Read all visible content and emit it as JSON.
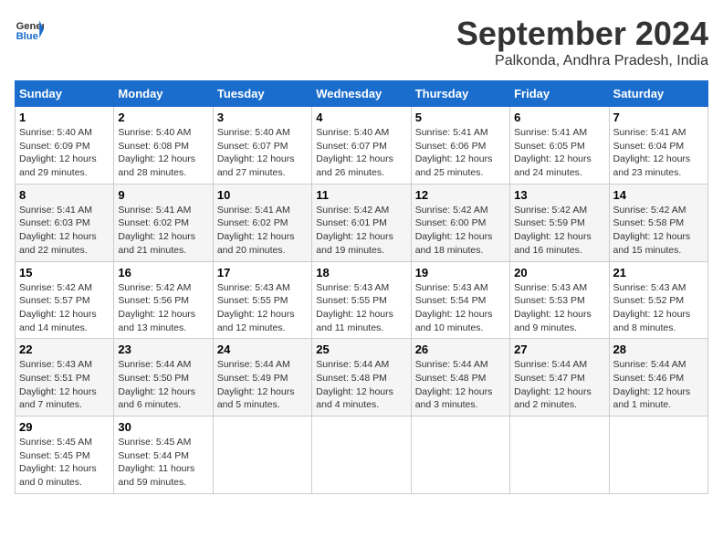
{
  "header": {
    "logo_general": "General",
    "logo_blue": "Blue",
    "month": "September 2024",
    "location": "Palkonda, Andhra Pradesh, India"
  },
  "weekdays": [
    "Sunday",
    "Monday",
    "Tuesday",
    "Wednesday",
    "Thursday",
    "Friday",
    "Saturday"
  ],
  "weeks": [
    [
      {
        "day": "1",
        "sunrise": "5:40 AM",
        "sunset": "6:09 PM",
        "daylight": "12 hours and 29 minutes."
      },
      {
        "day": "2",
        "sunrise": "5:40 AM",
        "sunset": "6:08 PM",
        "daylight": "12 hours and 28 minutes."
      },
      {
        "day": "3",
        "sunrise": "5:40 AM",
        "sunset": "6:07 PM",
        "daylight": "12 hours and 27 minutes."
      },
      {
        "day": "4",
        "sunrise": "5:40 AM",
        "sunset": "6:07 PM",
        "daylight": "12 hours and 26 minutes."
      },
      {
        "day": "5",
        "sunrise": "5:41 AM",
        "sunset": "6:06 PM",
        "daylight": "12 hours and 25 minutes."
      },
      {
        "day": "6",
        "sunrise": "5:41 AM",
        "sunset": "6:05 PM",
        "daylight": "12 hours and 24 minutes."
      },
      {
        "day": "7",
        "sunrise": "5:41 AM",
        "sunset": "6:04 PM",
        "daylight": "12 hours and 23 minutes."
      }
    ],
    [
      {
        "day": "8",
        "sunrise": "5:41 AM",
        "sunset": "6:03 PM",
        "daylight": "12 hours and 22 minutes."
      },
      {
        "day": "9",
        "sunrise": "5:41 AM",
        "sunset": "6:02 PM",
        "daylight": "12 hours and 21 minutes."
      },
      {
        "day": "10",
        "sunrise": "5:41 AM",
        "sunset": "6:02 PM",
        "daylight": "12 hours and 20 minutes."
      },
      {
        "day": "11",
        "sunrise": "5:42 AM",
        "sunset": "6:01 PM",
        "daylight": "12 hours and 19 minutes."
      },
      {
        "day": "12",
        "sunrise": "5:42 AM",
        "sunset": "6:00 PM",
        "daylight": "12 hours and 18 minutes."
      },
      {
        "day": "13",
        "sunrise": "5:42 AM",
        "sunset": "5:59 PM",
        "daylight": "12 hours and 16 minutes."
      },
      {
        "day": "14",
        "sunrise": "5:42 AM",
        "sunset": "5:58 PM",
        "daylight": "12 hours and 15 minutes."
      }
    ],
    [
      {
        "day": "15",
        "sunrise": "5:42 AM",
        "sunset": "5:57 PM",
        "daylight": "12 hours and 14 minutes."
      },
      {
        "day": "16",
        "sunrise": "5:42 AM",
        "sunset": "5:56 PM",
        "daylight": "12 hours and 13 minutes."
      },
      {
        "day": "17",
        "sunrise": "5:43 AM",
        "sunset": "5:55 PM",
        "daylight": "12 hours and 12 minutes."
      },
      {
        "day": "18",
        "sunrise": "5:43 AM",
        "sunset": "5:55 PM",
        "daylight": "12 hours and 11 minutes."
      },
      {
        "day": "19",
        "sunrise": "5:43 AM",
        "sunset": "5:54 PM",
        "daylight": "12 hours and 10 minutes."
      },
      {
        "day": "20",
        "sunrise": "5:43 AM",
        "sunset": "5:53 PM",
        "daylight": "12 hours and 9 minutes."
      },
      {
        "day": "21",
        "sunrise": "5:43 AM",
        "sunset": "5:52 PM",
        "daylight": "12 hours and 8 minutes."
      }
    ],
    [
      {
        "day": "22",
        "sunrise": "5:43 AM",
        "sunset": "5:51 PM",
        "daylight": "12 hours and 7 minutes."
      },
      {
        "day": "23",
        "sunrise": "5:44 AM",
        "sunset": "5:50 PM",
        "daylight": "12 hours and 6 minutes."
      },
      {
        "day": "24",
        "sunrise": "5:44 AM",
        "sunset": "5:49 PM",
        "daylight": "12 hours and 5 minutes."
      },
      {
        "day": "25",
        "sunrise": "5:44 AM",
        "sunset": "5:48 PM",
        "daylight": "12 hours and 4 minutes."
      },
      {
        "day": "26",
        "sunrise": "5:44 AM",
        "sunset": "5:48 PM",
        "daylight": "12 hours and 3 minutes."
      },
      {
        "day": "27",
        "sunrise": "5:44 AM",
        "sunset": "5:47 PM",
        "daylight": "12 hours and 2 minutes."
      },
      {
        "day": "28",
        "sunrise": "5:44 AM",
        "sunset": "5:46 PM",
        "daylight": "12 hours and 1 minute."
      }
    ],
    [
      {
        "day": "29",
        "sunrise": "5:45 AM",
        "sunset": "5:45 PM",
        "daylight": "12 hours and 0 minutes."
      },
      {
        "day": "30",
        "sunrise": "5:45 AM",
        "sunset": "5:44 PM",
        "daylight": "11 hours and 59 minutes."
      },
      null,
      null,
      null,
      null,
      null
    ]
  ],
  "labels": {
    "sunrise_prefix": "Sunrise: ",
    "sunset_prefix": "Sunset: ",
    "daylight_prefix": "Daylight: "
  }
}
